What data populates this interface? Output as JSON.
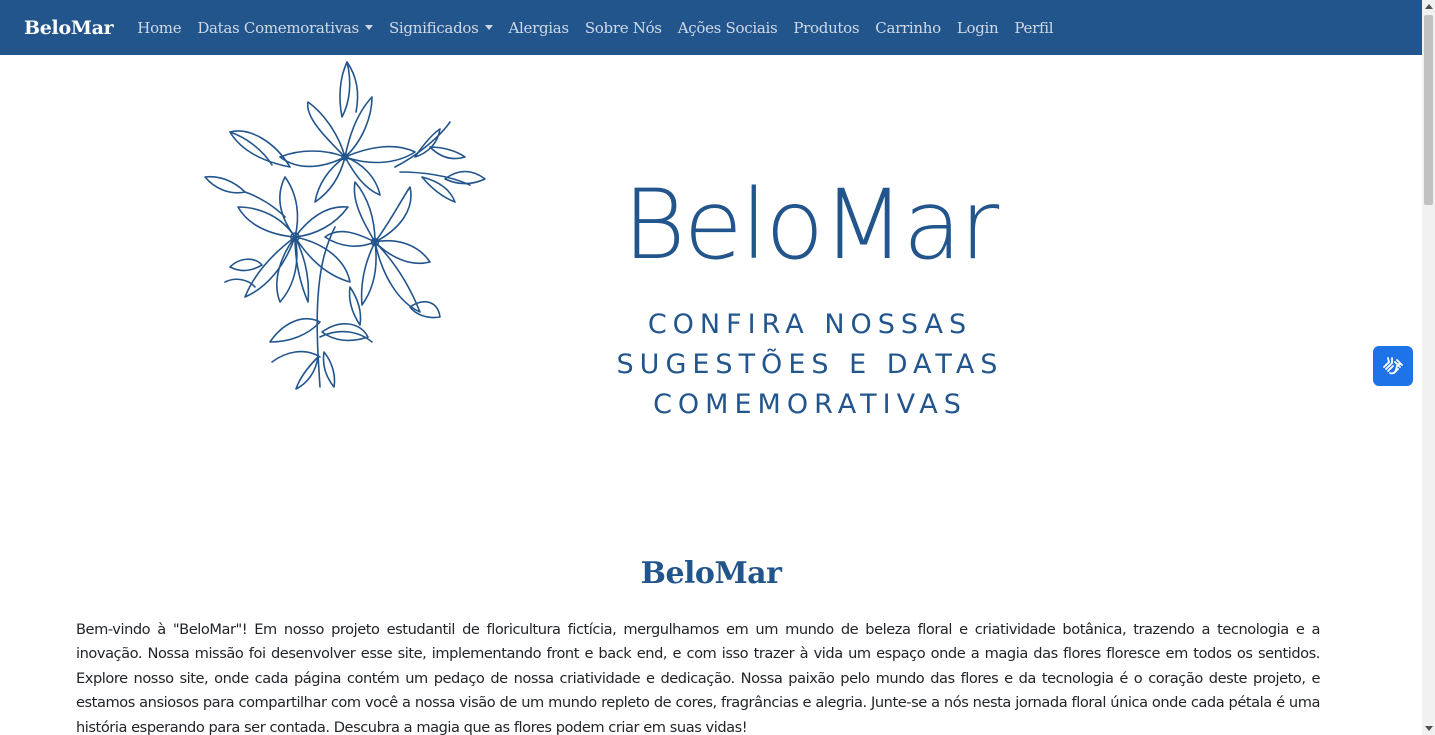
{
  "navbar": {
    "brand": "BeloMar",
    "links": [
      {
        "label": "Home"
      },
      {
        "label": "Datas Comemorativas"
      },
      {
        "label": "Significados"
      },
      {
        "label": "Alergias"
      },
      {
        "label": "Sobre Nós"
      },
      {
        "label": "Ações Sociais"
      },
      {
        "label": "Produtos"
      },
      {
        "label": "Carrinho"
      },
      {
        "label": "Login"
      },
      {
        "label": "Perfil"
      }
    ]
  },
  "hero": {
    "title": "BeloMar",
    "subtitle_lines": [
      "CONFIRA NOSSAS",
      "SUGESTÕES E DATAS",
      "COMEMORATIVAS"
    ],
    "illustration_icon": "lily-flowers-illustration"
  },
  "about": {
    "title": "BeloMar",
    "text": "Bem-vindo à \"BeloMar\"! Em nosso projeto estudantil de floricultura fictícia, mergulhamos em um mundo de beleza floral e criatividade botânica, trazendo a tecnologia e a inovação. Nossa missão foi desenvolver esse site, implementando front e back end, e com isso trazer à vida um espaço onde a magia das flores floresce em todos os sentidos. Explore nosso site, onde cada página contém um pedaço de nossa criatividade e dedicação. Nossa paixão pelo mundo das flores e da tecnologia é o coração deste projeto, e estamos ansiosos para compartilhar com você a nossa visão de um mundo repleto de cores, fragrâncias e alegria. Junte-se a nós nesta jornada floral única onde cada pétala é uma história esperando para ser contada. Descubra a magia que as flores podem criar em suas vidas!"
  },
  "accessibility": {
    "icon": "sign-language-hands-icon"
  },
  "colors": {
    "primary": "#23558d",
    "accessibility_button": "#1f73e8"
  }
}
